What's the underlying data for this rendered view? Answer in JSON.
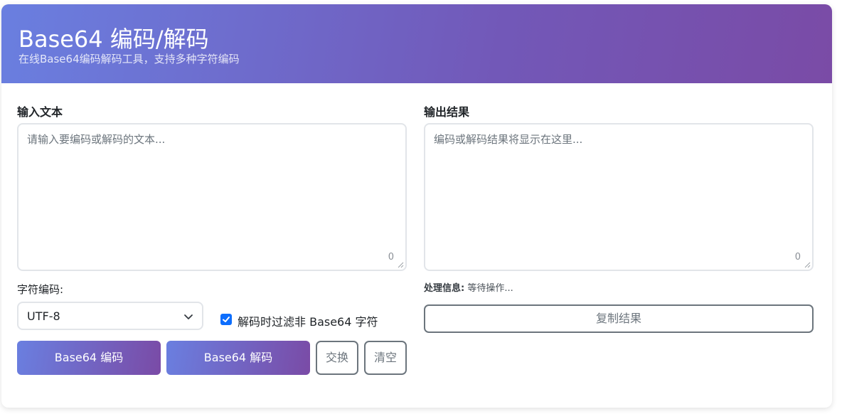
{
  "header": {
    "title": "Base64 编码/解码",
    "subtitle": "在线Base64编码解码工具，支持多种字符编码"
  },
  "input": {
    "label": "输入文本",
    "placeholder": "请输入要编码或解码的文本...",
    "char_count": "0"
  },
  "output": {
    "label": "输出结果",
    "placeholder": "编码或解码结果将显示在这里...",
    "char_count": "0"
  },
  "encoding": {
    "label": "字符编码:",
    "selected": "UTF-8"
  },
  "filter_option": {
    "label": "解码时过滤非 Base64 字符",
    "checked": true
  },
  "buttons": {
    "encode": "Base64 编码",
    "decode": "Base64 解码",
    "swap": "交换",
    "clear": "清空",
    "copy": "复制结果"
  },
  "status": {
    "label": "处理信息:",
    "text": "等待操作..."
  },
  "colors": {
    "gradient_start": "#6a7fe0",
    "gradient_end": "#7a4ba6",
    "checkbox": "#0d6efd",
    "outline_button": "#6c757d"
  }
}
